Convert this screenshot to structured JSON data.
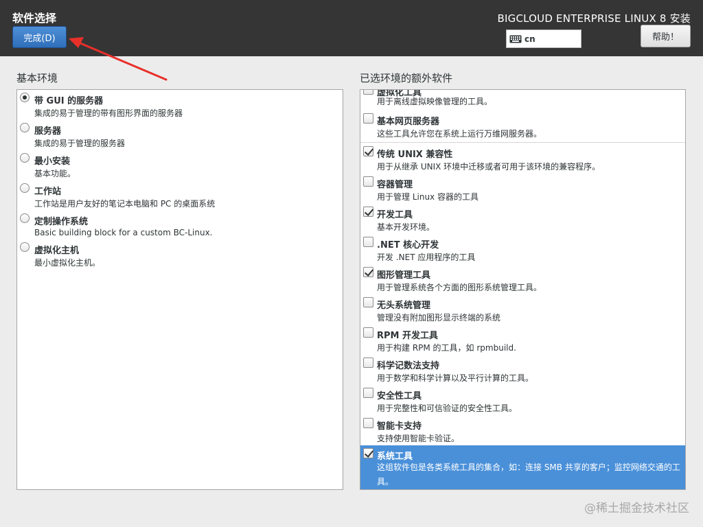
{
  "header": {
    "title": "软件选择",
    "done_label": "完成(D)",
    "product": "BIGCLOUD ENTERPRISE LINUX 8 安装",
    "keyboard_layout": "cn",
    "help_label": "帮助！"
  },
  "base_env": {
    "title": "基本环境",
    "items": [
      {
        "name": "带 GUI 的服务器",
        "desc": "集成的易于管理的带有图形界面的服务器",
        "selected": true
      },
      {
        "name": "服务器",
        "desc": "集成的易于管理的服务器",
        "selected": false
      },
      {
        "name": "最小安装",
        "desc": "基本功能。",
        "selected": false
      },
      {
        "name": "工作站",
        "desc": "工作站是用户友好的笔记本电脑和 PC 的桌面系统",
        "selected": false
      },
      {
        "name": "定制操作系统",
        "desc": "Basic building block for a custom BC-Linux.",
        "selected": false
      },
      {
        "name": "虚拟化主机",
        "desc": "最小虚拟化主机。",
        "selected": false
      }
    ]
  },
  "addons": {
    "title": "已选环境的额外软件",
    "items": [
      {
        "name": "虚拟化工具",
        "desc": "用于离线虚拟映像管理的工具。",
        "checked": false
      },
      {
        "name": "基本网页服务器",
        "desc": "这些工具允许您在系统上运行万维网服务器。",
        "checked": false
      },
      {
        "name": "传统 UNIX 兼容性",
        "desc": "用于从继承 UNIX 环境中迁移或者可用于该环境的兼容程序。",
        "checked": true
      },
      {
        "name": "容器管理",
        "desc": "用于管理 Linux 容器的工具",
        "checked": false
      },
      {
        "name": "开发工具",
        "desc": "基本开发环境。",
        "checked": true
      },
      {
        "name": ".NET 核心开发",
        "desc": "开发 .NET 应用程序的工具",
        "checked": false
      },
      {
        "name": "图形管理工具",
        "desc": "用于管理系统各个方面的图形系统管理工具。",
        "checked": true
      },
      {
        "name": "无头系统管理",
        "desc": "管理没有附加图形显示终端的系统",
        "checked": false
      },
      {
        "name": "RPM 开发工具",
        "desc": "用于构建 RPM 的工具，如 rpmbuild.",
        "checked": false
      },
      {
        "name": "科学记数法支持",
        "desc": "用于数学和科学计算以及平行计算的工具。",
        "checked": false
      },
      {
        "name": "安全性工具",
        "desc": "用于完整性和可信验证的安全性工具。",
        "checked": false
      },
      {
        "name": "智能卡支持",
        "desc": "支持使用智能卡验证。",
        "checked": false
      },
      {
        "name": "系统工具",
        "desc": "这组软件包是各类系统工具的集合，如：连接 SMB 共享的客户；监控网络交通的工具。",
        "checked": true,
        "highlighted": true
      }
    ]
  },
  "watermark": "@稀土掘金技术社区",
  "colors": {
    "header_bg": "#353535",
    "accent": "#4a90d9",
    "annotation_arrow": "#e8302a"
  }
}
